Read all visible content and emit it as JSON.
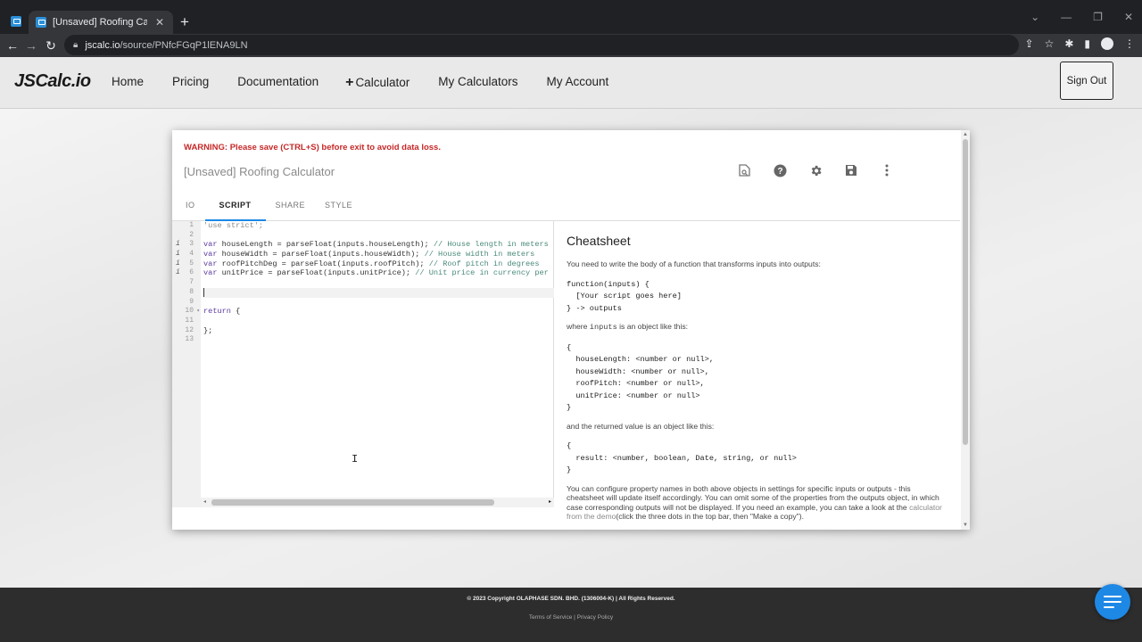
{
  "browser": {
    "tab_title": "[Unsaved] Roofing Calculator - J",
    "url_host": "jscalc.io",
    "url_path": "/source/PNfcFGqP1lENA9LN"
  },
  "header": {
    "logo": "JSCalc.io",
    "nav": [
      {
        "label": "Home"
      },
      {
        "label": "Pricing"
      },
      {
        "label": "Documentation"
      },
      {
        "label": "Calculator",
        "prefix": "+"
      },
      {
        "label": "My Calculators"
      },
      {
        "label": "My Account"
      }
    ],
    "sign_out": "Sign Out"
  },
  "editor": {
    "warning": "WARNING: Please save (CTRL+S) before exit to avoid data loss.",
    "title": "[Unsaved] Roofing Calculator",
    "toolbar_icons": [
      "preview-icon",
      "help-icon",
      "settings-icon",
      "save-icon",
      "more-vert-icon"
    ],
    "tabs": [
      {
        "label": "IO",
        "active": false
      },
      {
        "label": "SCRIPT",
        "active": true
      },
      {
        "label": "SHARE",
        "active": false
      },
      {
        "label": "STYLE",
        "active": false
      }
    ],
    "code": {
      "l1": "'use strict';",
      "l3_kw": "var",
      "l3_code": " houseLength = parseFloat(inputs.houseLength); ",
      "l3_cm": "// House length in meters",
      "l4_kw": "var",
      "l4_code": " houseWidth = parseFloat(inputs.houseWidth); ",
      "l4_cm": "// House width in meters",
      "l5_kw": "var",
      "l5_code": " roofPitchDeg = parseFloat(inputs.roofPitch); ",
      "l5_cm": "// Roof pitch in degrees",
      "l6_kw": "var",
      "l6_code": " unitPrice = parseFloat(inputs.unitPrice); ",
      "l6_cm": "// Unit price in currency per",
      "l10_kw": "return",
      "l10_code": " {",
      "l12": "};"
    }
  },
  "cheatsheet": {
    "title": "Cheatsheet",
    "intro": "You need to write the body of a function that transforms inputs into outputs:",
    "func_block": "function(inputs) {\n  [Your script goes here]\n} -> outputs",
    "where_a": "where ",
    "where_code": "inputs",
    "where_b": " is an object like this:",
    "inputs_block": "{\n  houseLength: <number or null>,\n  houseWidth: <number or null>,\n  roofPitch: <number or null>,\n  unitPrice: <number or null>\n}",
    "returned": "and the returned value is an object like this:",
    "outputs_block": "{\n  result: <number, boolean, Date, string, or null>\n}",
    "config_a": "You can configure property names in both above objects in settings for specific inputs or outputs - this cheatsheet will update itself accordingly. You can omit some of the properties from the outputs object, in which case corresponding outputs will not be displayed. If you need an example, you can take a look at the ",
    "config_link": "calculator from the demo",
    "config_b": "(click the three dots in the top bar, then \"Make a copy\")."
  },
  "footer": {
    "copyright": "© 2023 Copyright OLAPHASE SDN. BHD. (1306004-K) | All Rights Reserved.",
    "terms": "Terms of Service",
    "sep": " | ",
    "privacy": "Privacy Policy"
  },
  "colors": {
    "accent": "#1e88e5",
    "warning": "#c62828",
    "footer_bg": "#2d2d2d"
  }
}
